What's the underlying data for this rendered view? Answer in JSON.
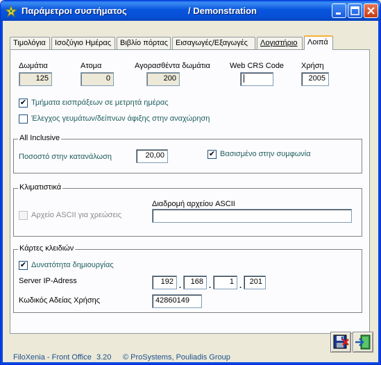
{
  "window": {
    "title_left": "Παράμετροι συστήματος",
    "title_right": "/ Demonstration"
  },
  "tabs": [
    {
      "label": "Τιμολόγια"
    },
    {
      "label": "Ισοζύγιο Ημέρας"
    },
    {
      "label": "Βιβλίο πόρτας"
    },
    {
      "label": "Εισαγωγές/Εξαγωγές"
    },
    {
      "label": "Λογιστήριο"
    },
    {
      "label": "Λοιπά",
      "active": true
    }
  ],
  "stats": {
    "rooms_label": "Δωμάτια",
    "rooms_value": "125",
    "persons_label": "Ατομα",
    "persons_value": "0",
    "bought_label": "Αγορασθέντα δωμάτια",
    "bought_value": "200",
    "crs_label": "Web CRS Code",
    "crs_value": "",
    "year_label": "Χρήση",
    "year_value": "2005"
  },
  "options": {
    "cash_sections_label": "Τμήματα εισπράξεων σε μετρητά ημέρας",
    "cash_sections_checked": true,
    "meals_check_label": "Έλεγχος γευμάτων/δείπνων άφιξης στην αναχώρηση",
    "meals_check_checked": false
  },
  "all_inclusive": {
    "title": "All Inclusive",
    "percent_label": "Ποσοστό στην κατανάλωση",
    "percent_value": "20,00",
    "agreement_label": "Βασισμένο στην συμφωνία",
    "agreement_checked": true
  },
  "aircon": {
    "title": "Κλιματιστικά",
    "ascii_label": "Αρχείο ASCII για χρεώσεις",
    "ascii_checked": false,
    "path_label": "Διαδρομή αρχείου ASCII",
    "path_value": ""
  },
  "keycards": {
    "title": "Κάρτες κλειδιών",
    "create_label": "Δυνατότητα δημιουργίας",
    "create_checked": true,
    "server_label": "Server IP-Adress",
    "ip": [
      "192",
      "168",
      "1",
      "201"
    ],
    "license_label": "Κωδικός Αδείας Χρήσης",
    "license_value": "42860149"
  },
  "footer": {
    "product": "FiloXenia - Front Office",
    "version": "3.20",
    "copyright": "© ProSystems, Pouliadis Group"
  },
  "icons": {
    "save": "save-disk-icon",
    "exit": "exit-door-icon"
  }
}
